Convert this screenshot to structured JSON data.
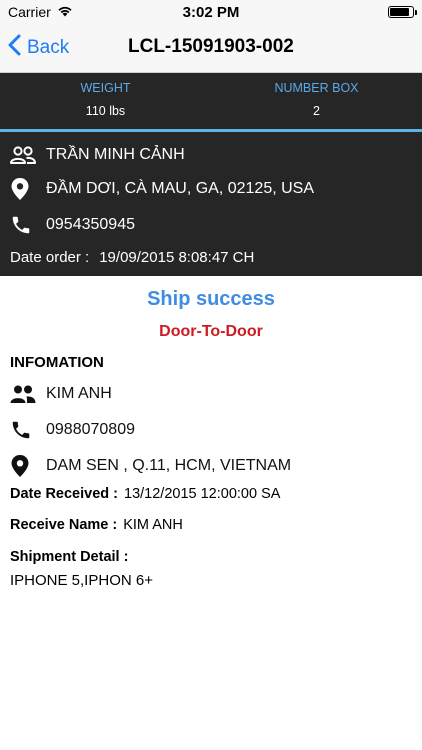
{
  "status_bar": {
    "carrier": "Carrier",
    "time": "3:02 PM",
    "battery_level": 1.0
  },
  "nav": {
    "back_label": "Back",
    "title": "LCL-15091903-002"
  },
  "stats": {
    "weight_label": "WEIGHT",
    "weight_value": "110 lbs",
    "boxes_label": "NUMBER BOX",
    "boxes_value": "2"
  },
  "sender": {
    "name": "TRẦN MINH CẢNH",
    "address": "ĐẦM DƠI, CÀ MAU, GA, 02125, USA",
    "phone": "0954350945",
    "date_order_label": "Date order :",
    "date_order_value": "19/09/2015 8:08:47 CH"
  },
  "shipment": {
    "status": "Ship success",
    "type": "Door-To-Door",
    "info_title": "INFOMATION"
  },
  "receiver": {
    "name": "KIM ANH",
    "phone": "0988070809",
    "address": "DAM SEN , Q.11, HCM, VIETNAM",
    "date_received_label": "Date Received :",
    "date_received_value": "13/12/2015 12:00:00 SA",
    "receive_name_label": "Receive Name :",
    "receive_name_value": "KIM ANH",
    "detail_label": "Shipment Detail :",
    "detail_value": "IPHONE 5,IPHON 6+"
  },
  "colors": {
    "accent": "#1e7cf6",
    "status_blue": "#3f8de0",
    "type_red": "#cc1b22",
    "stat_label": "#5aa9ea",
    "divider": "#5bb3e6",
    "dark_bg": "#262626"
  },
  "icons": [
    "wifi-icon",
    "battery-icon",
    "back-chevron-icon",
    "person-outline-icon",
    "location-pin-icon",
    "phone-icon",
    "people-icon"
  ]
}
